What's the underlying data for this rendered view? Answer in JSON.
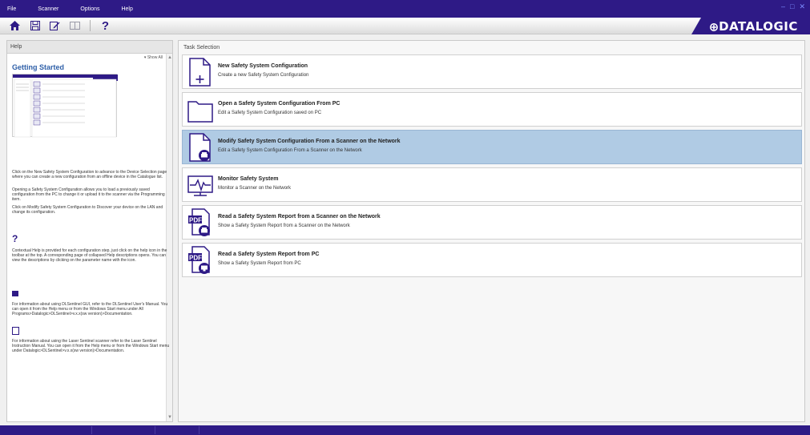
{
  "menu": {
    "items": [
      {
        "label": "File"
      },
      {
        "label": "Scanner"
      },
      {
        "label": "Options"
      },
      {
        "label": "Help"
      }
    ]
  },
  "window_controls": {
    "minimize": "–",
    "restore": "□",
    "close": "✕"
  },
  "toolbar": {
    "home_icon": "home-icon",
    "save_icon": "save-icon",
    "edit_icon": "edit-icon",
    "compare_icon": "compare-icon",
    "help_glyph": "?"
  },
  "brand": {
    "logo_text": "DATALOGIC",
    "accent": "#2e1a86"
  },
  "help": {
    "header": "Help",
    "show_all": "▾ Show All",
    "getting_started": "Getting Started",
    "para1": "Click on the New Safety System Configuration to advance to the Device Selection page where you can create a new configuration from an offline device in the Catalogue list.",
    "para2": "Opening a Safety System Configuration allows you to load a previously saved configuration from the PC to change it or upload it to the scanner via the Programming item.",
    "para3": "Click on Modify Safety System Configuration to Discover your device on the LAN and change its configuration.",
    "contextual_icon": "?",
    "para4": "Contextual Help is provided for each configuration step, just click on the help icon in the toolbar at the top. A corresponding page of collapsed Help descriptions opens. You can view the descriptions by clicking on the parameter name with the icon.",
    "para5": "For information about using DLSentinel GUI, refer to the DLSentinel User's Manual. You can open it from the Help menu or from the Windows Start menu under All Programs>Datalogic>DLSentinel>v.x.x(sw version)>Documentation.",
    "para6": "For information about using the Laser Sentinel scanner refer to the Laser Sentinel Instruction Manual. You can open it from the Help menu or from the Windows Start menu under Datalogic>DLSentinel>v.x.x(sw version)>Documentation."
  },
  "tasks": {
    "header": "Task Selection",
    "items": [
      {
        "title": "New Safety System Configuration",
        "desc": "Create a new Safety System Configuration",
        "icon": "new-document-icon",
        "selected": false
      },
      {
        "title": "Open a Safety System Configuration From PC",
        "desc": "Edit a Safety System Configuration saved on PC",
        "icon": "folder-icon",
        "selected": false
      },
      {
        "title": "Modify Safety System Configuration From a Scanner on the Network",
        "desc": "Edit a Safety System Configuration From a Scanner on the Network",
        "icon": "scanner-document-icon",
        "selected": true
      },
      {
        "title": "Monitor Safety System",
        "desc": "Monitor a Scanner on the Network",
        "icon": "monitor-waveform-icon",
        "selected": false
      },
      {
        "title": "Read a Safety System Report from a Scanner on the Network",
        "desc": "Show a Safety System Report from a Scanner on the Network",
        "icon": "pdf-scanner-icon",
        "selected": false
      },
      {
        "title": "Read a Safety System Report from PC",
        "desc": "Show a Safety System Report from PC",
        "icon": "pdf-pc-icon",
        "selected": false
      }
    ]
  }
}
